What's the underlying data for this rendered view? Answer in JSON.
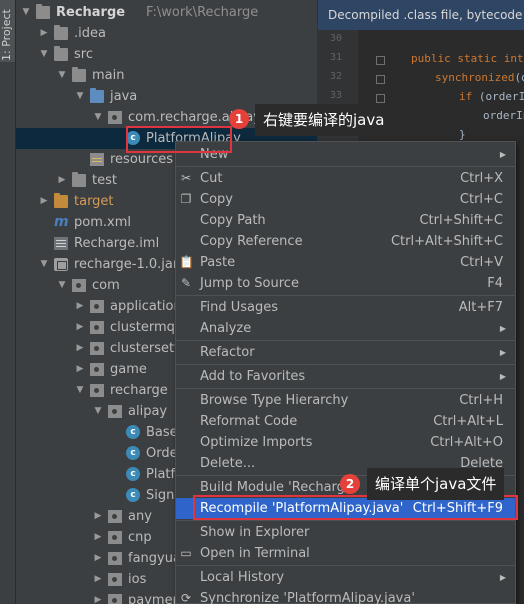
{
  "tool_strip": {
    "tab_label": "1: Project"
  },
  "tree": [
    {
      "label": "Recharge",
      "extra": "F:\\work\\Recharge",
      "icon": "root-folder-icon",
      "depth": 0,
      "arrow": "down",
      "bold": true
    },
    {
      "label": ".idea",
      "icon": "folder-icon",
      "depth": 1,
      "arrow": "right"
    },
    {
      "label": "src",
      "icon": "folder-icon",
      "depth": 1,
      "arrow": "down"
    },
    {
      "label": "main",
      "icon": "folder-icon",
      "depth": 2,
      "arrow": "down"
    },
    {
      "label": "java",
      "icon": "source-folder-icon",
      "depth": 3,
      "arrow": "down"
    },
    {
      "label": "com.recharge.alipay",
      "icon": "package-icon",
      "depth": 4,
      "arrow": "down"
    },
    {
      "label": "PlatformAlipay",
      "icon": "class-icon",
      "depth": 5,
      "arrow": "none",
      "selected": true
    },
    {
      "label": "resources",
      "icon": "resources-folder-icon",
      "depth": 3,
      "arrow": "none"
    },
    {
      "label": "test",
      "icon": "folder-icon",
      "depth": 2,
      "arrow": "right"
    },
    {
      "label": "target",
      "icon": "excluded-folder-icon",
      "depth": 1,
      "arrow": "right",
      "orange": true
    },
    {
      "label": "pom.xml",
      "icon": "maven-icon",
      "depth": 1,
      "arrow": "none"
    },
    {
      "label": "Recharge.iml",
      "icon": "module-file-icon",
      "depth": 1,
      "arrow": "none"
    },
    {
      "label": "recharge-1.0.jar",
      "icon": "jar-icon",
      "depth": 1,
      "arrow": "down"
    },
    {
      "label": "com",
      "icon": "package-icon",
      "depth": 2,
      "arrow": "down"
    },
    {
      "label": "application",
      "icon": "package-icon",
      "depth": 3,
      "arrow": "right"
    },
    {
      "label": "clustermq",
      "icon": "package-icon",
      "depth": 3,
      "arrow": "right"
    },
    {
      "label": "clustersetting",
      "icon": "package-icon",
      "depth": 3,
      "arrow": "right"
    },
    {
      "label": "game",
      "icon": "package-icon",
      "depth": 3,
      "arrow": "right"
    },
    {
      "label": "recharge",
      "icon": "package-icon",
      "depth": 3,
      "arrow": "down"
    },
    {
      "label": "alipay",
      "icon": "package-icon",
      "depth": 4,
      "arrow": "down"
    },
    {
      "label": "BaseOrder",
      "icon": "class-icon",
      "depth": 5,
      "arrow": "none"
    },
    {
      "label": "OrderAlipay",
      "icon": "class-icon",
      "depth": 5,
      "arrow": "none"
    },
    {
      "label": "PlatformAlipay",
      "icon": "class-icon",
      "depth": 5,
      "arrow": "none"
    },
    {
      "label": "SignUtil",
      "icon": "class-icon",
      "depth": 5,
      "arrow": "none"
    },
    {
      "label": "any",
      "icon": "package-icon",
      "depth": 4,
      "arrow": "right"
    },
    {
      "label": "cnp",
      "icon": "package-icon",
      "depth": 4,
      "arrow": "right"
    },
    {
      "label": "fangyuan",
      "icon": "package-icon",
      "depth": 4,
      "arrow": "right"
    },
    {
      "label": "ios",
      "icon": "package-icon",
      "depth": 4,
      "arrow": "right"
    },
    {
      "label": "payment",
      "icon": "package-icon",
      "depth": 4,
      "arrow": "right"
    }
  ],
  "editor": {
    "banner": "Decompiled .class file, bytecode version",
    "line_numbers": [
      "30",
      "31",
      "32",
      "33",
      "34"
    ],
    "code_lines": [
      {
        "kw": "public static int ",
        "rest": "g"
      },
      {
        "kw": "synchronized",
        "rest": "(ord"
      },
      {
        "kw": "if ",
        "rest": "(orderIn"
      },
      {
        "kw": "",
        "rest": "orderIn"
      },
      {
        "kw": "",
        "rest": "}"
      }
    ]
  },
  "menu": {
    "items": [
      {
        "label": "New",
        "shortcut": "",
        "icon": "",
        "submenu": true,
        "sep_before": false
      },
      {
        "label": "Cut",
        "shortcut": "Ctrl+X",
        "icon": "scissors-icon",
        "submenu": false,
        "sep_before": true
      },
      {
        "label": "Copy",
        "shortcut": "Ctrl+C",
        "icon": "copy-icon",
        "submenu": false,
        "sep_before": false
      },
      {
        "label": "Copy Path",
        "shortcut": "Ctrl+Shift+C",
        "icon": "",
        "submenu": false,
        "sep_before": false
      },
      {
        "label": "Copy Reference",
        "shortcut": "Ctrl+Alt+Shift+C",
        "icon": "",
        "submenu": false,
        "sep_before": false
      },
      {
        "label": "Paste",
        "shortcut": "Ctrl+V",
        "icon": "clipboard-icon",
        "submenu": false,
        "sep_before": false
      },
      {
        "label": "Jump to Source",
        "shortcut": "F4",
        "icon": "pencil-icon",
        "submenu": false,
        "sep_before": false
      },
      {
        "label": "Find Usages",
        "shortcut": "Alt+F7",
        "icon": "",
        "submenu": false,
        "sep_before": true
      },
      {
        "label": "Analyze",
        "shortcut": "",
        "icon": "",
        "submenu": true,
        "sep_before": false
      },
      {
        "label": "Refactor",
        "shortcut": "",
        "icon": "",
        "submenu": true,
        "sep_before": true
      },
      {
        "label": "Add to Favorites",
        "shortcut": "",
        "icon": "",
        "submenu": true,
        "sep_before": true
      },
      {
        "label": "Browse Type Hierarchy",
        "shortcut": "Ctrl+H",
        "icon": "",
        "submenu": false,
        "sep_before": true
      },
      {
        "label": "Reformat Code",
        "shortcut": "Ctrl+Alt+L",
        "icon": "",
        "submenu": false,
        "sep_before": false
      },
      {
        "label": "Optimize Imports",
        "shortcut": "Ctrl+Alt+O",
        "icon": "",
        "submenu": false,
        "sep_before": false
      },
      {
        "label": "Delete...",
        "shortcut": "Delete",
        "icon": "",
        "submenu": false,
        "sep_before": false
      },
      {
        "label": "Build Module 'Recharge'",
        "shortcut": "",
        "icon": "",
        "submenu": false,
        "sep_before": true
      },
      {
        "label": "Recompile 'PlatformAlipay.java'",
        "shortcut": "Ctrl+Shift+F9",
        "icon": "",
        "submenu": false,
        "sep_before": false,
        "highlighted": true
      },
      {
        "label": "Show in Explorer",
        "shortcut": "",
        "icon": "",
        "submenu": false,
        "sep_before": true
      },
      {
        "label": "Open in Terminal",
        "shortcut": "",
        "icon": "terminal-icon",
        "submenu": false,
        "sep_before": false
      },
      {
        "label": "Local History",
        "shortcut": "",
        "icon": "",
        "submenu": true,
        "sep_before": true
      },
      {
        "label": "Synchronize 'PlatformAlipay.java'",
        "shortcut": "",
        "icon": "sync-icon",
        "submenu": false,
        "sep_before": false
      }
    ]
  },
  "annotations": {
    "callout_1": {
      "number": "1",
      "text": "右键要编译的java"
    },
    "callout_2": {
      "number": "2",
      "text": "编译单个java文件"
    }
  },
  "colors": {
    "accent": "#2f65ca",
    "annotation_red": "#e0353e",
    "selection": "#0d293e"
  }
}
